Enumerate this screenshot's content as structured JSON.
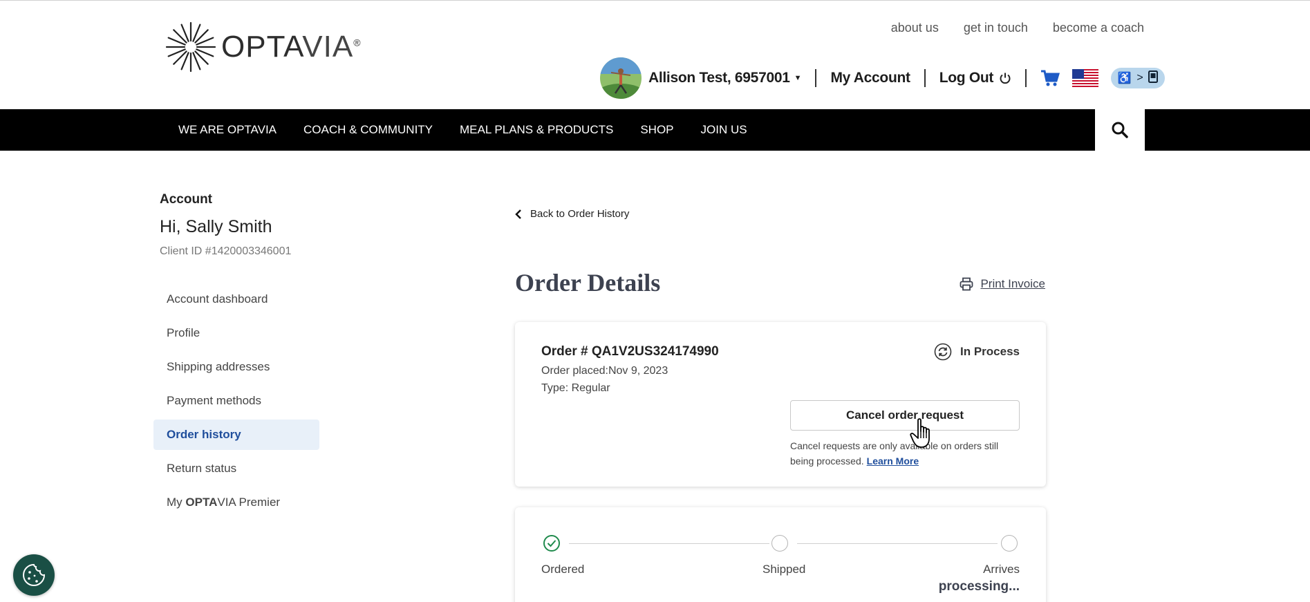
{
  "header": {
    "logo_text_bold": "OPTA",
    "logo_text_light": "VIA",
    "utility_links": [
      "about us",
      "get in touch",
      "become a coach"
    ],
    "user_name": "Allison Test, 6957001",
    "my_account": "My Account",
    "log_out": "Log Out"
  },
  "nav": {
    "items": [
      "WE ARE OPTAVIA",
      "COACH & COMMUNITY",
      "MEAL PLANS & PRODUCTS",
      "SHOP",
      "JOIN US"
    ]
  },
  "sidebar": {
    "title": "Account",
    "greeting": "Hi, Sally Smith",
    "client_id": "Client ID #1420003346001",
    "items": [
      {
        "label": "Account dashboard"
      },
      {
        "label": "Profile"
      },
      {
        "label": "Shipping addresses"
      },
      {
        "label": "Payment methods"
      },
      {
        "label": "Order history",
        "active": true
      },
      {
        "label": "Return status"
      },
      {
        "label_prefix": "My ",
        "label_bold": "OPTA",
        "label_suffix": "VIA Premier"
      }
    ]
  },
  "main": {
    "back_link": "Back to Order History",
    "title": "Order Details",
    "print_invoice": "Print Invoice",
    "order": {
      "number": "Order # QA1V2US324174990",
      "placed": "Order placed:Nov 9, 2023",
      "type": "Type: Regular",
      "status": "In Process",
      "cancel_button": "Cancel order request",
      "cancel_note": "Cancel requests are only available on orders still being processed.",
      "learn_more": "Learn More"
    },
    "tracker": {
      "steps": [
        "Ordered",
        "Shipped",
        "Arrives"
      ],
      "current_step_index": 0,
      "arrives_status": "processing..."
    }
  },
  "colors": {
    "nav_bg": "#000000",
    "accent_blue": "#1f4e9c",
    "active_bg": "#e8f0f9",
    "success_green": "#1f8a4c",
    "cookie_bg": "#1a4f45"
  }
}
